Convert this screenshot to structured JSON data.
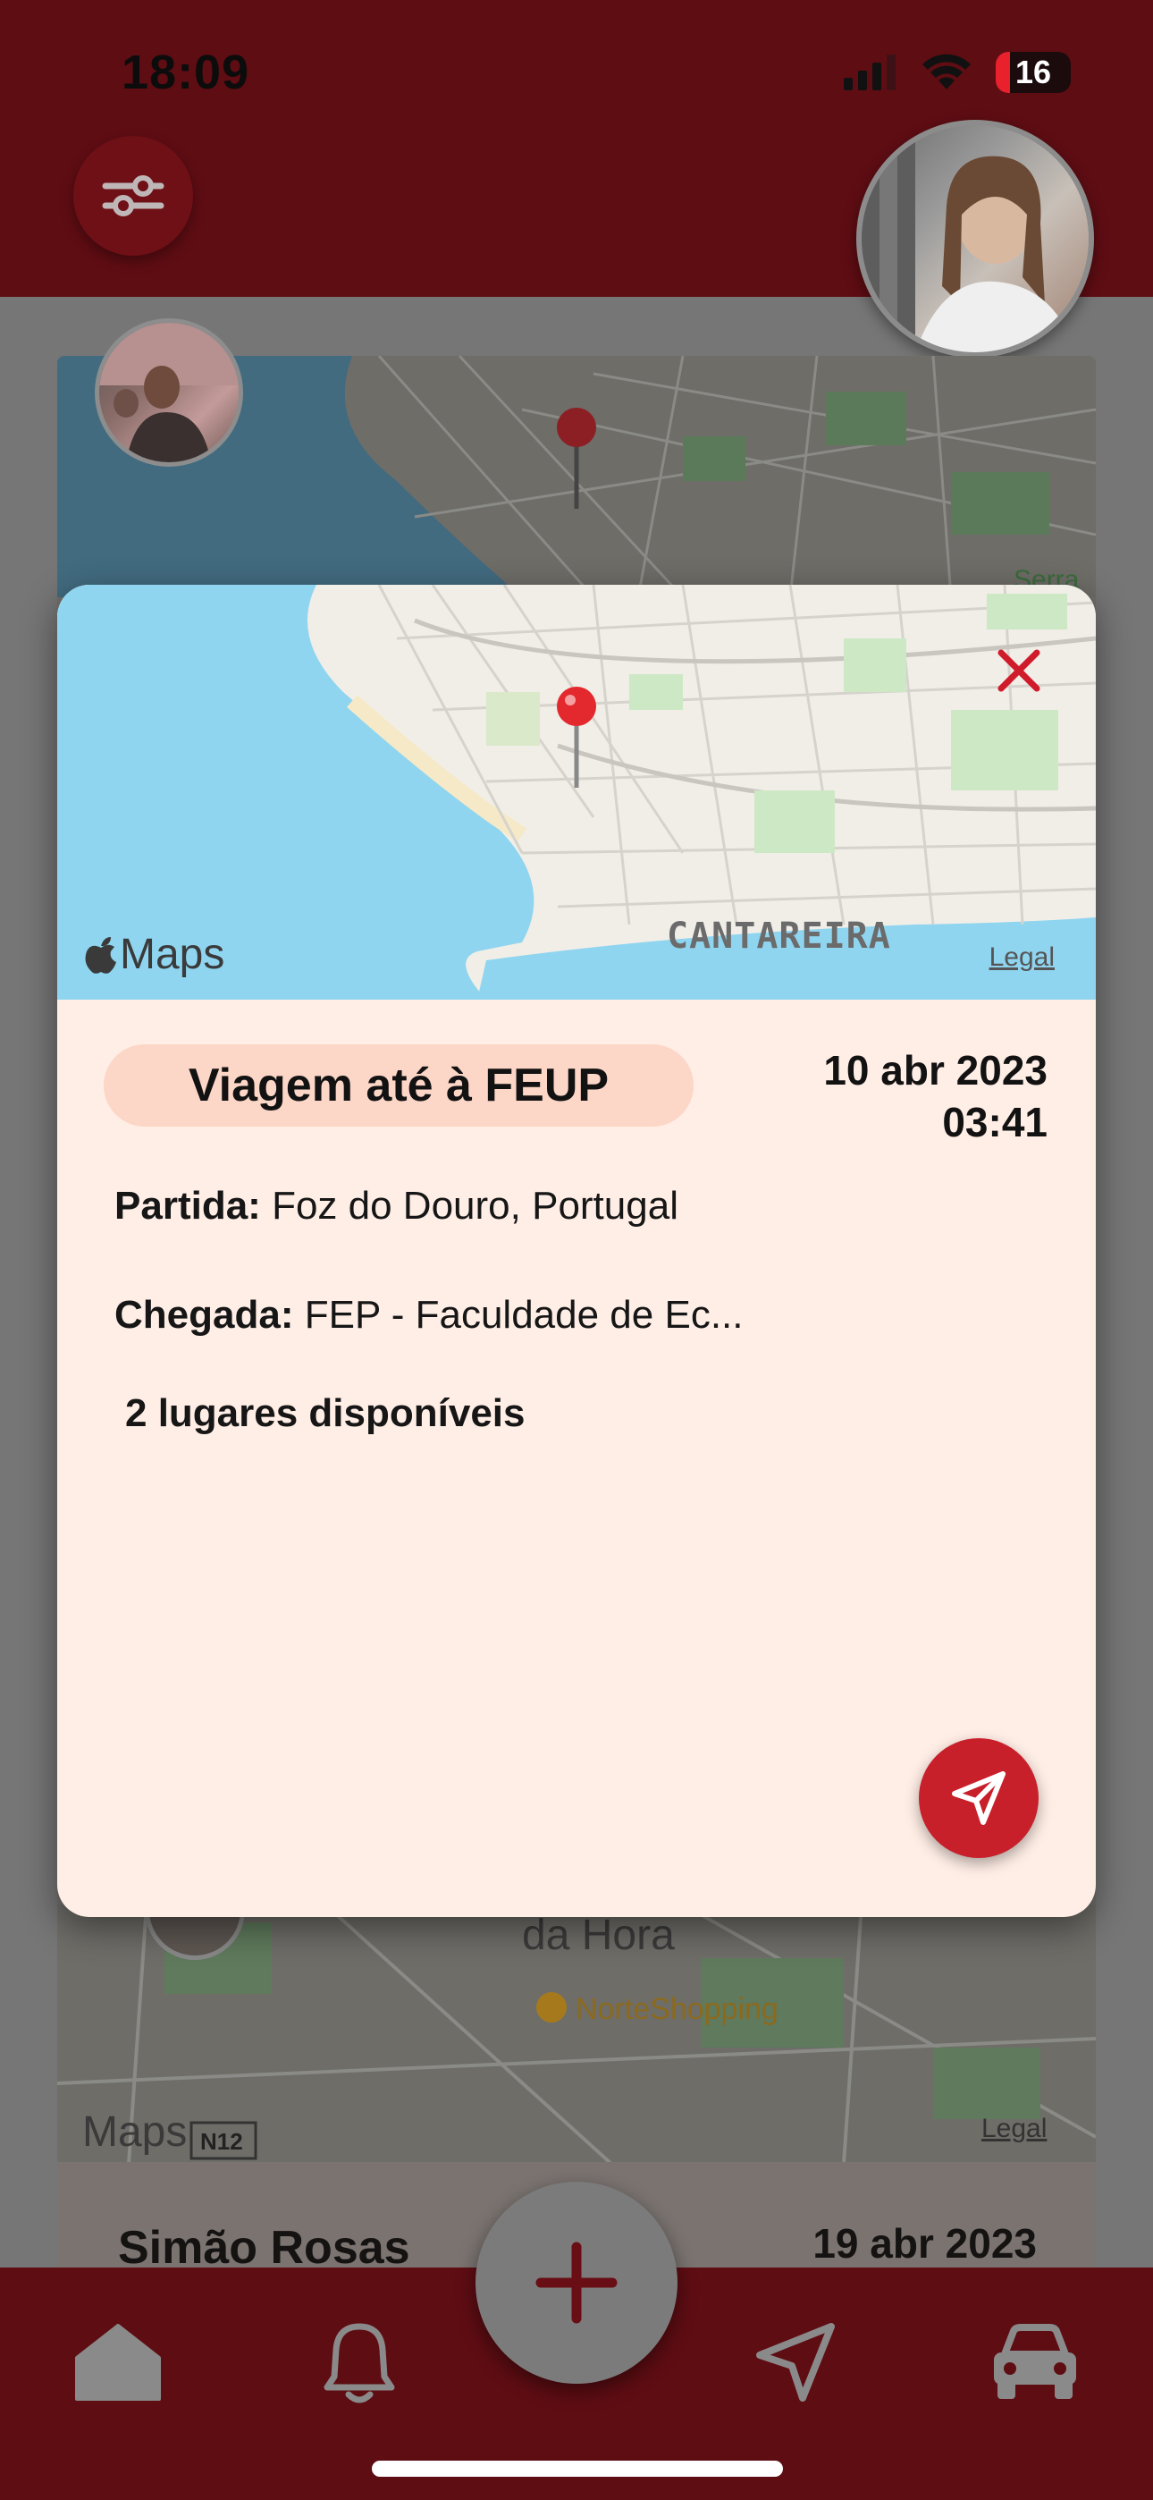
{
  "status_bar": {
    "time": "18:09",
    "battery": "16"
  },
  "header": {
    "filter_icon": "sliders-icon",
    "user_avatar": "avatar"
  },
  "modal": {
    "map": {
      "brand": "Maps",
      "legal": "Legal",
      "place_label": "CANTAREIRA",
      "close_icon": "close-icon"
    },
    "trip_title": "Viagem até à FEUP",
    "date": "10 abr 2023",
    "time": "03:41",
    "departure_label": "Partida:",
    "departure_value": "Foz do Douro, Portugal",
    "arrival_label": "Chegada:",
    "arrival_value": "FEP - Faculdade de Ec...",
    "seats": "2 lugares disponíveis",
    "send_icon": "send-icon"
  },
  "background_card": {
    "map_top_label": "Serra",
    "map_bottom_labels": [
      "da Hora",
      "NorteShopping",
      "N12"
    ],
    "brand": "Maps",
    "legal": "Legal",
    "driver_name": "Simão Rosas",
    "date": "19 abr 2023"
  },
  "bottom_nav": {
    "items": [
      "home-icon",
      "bell-icon",
      "add-icon",
      "navigation-icon",
      "car-icon"
    ]
  },
  "colors": {
    "brand": "#5e0d13",
    "accent": "#c8202a",
    "card": "#ffeee6",
    "pill": "#fcd6c6"
  }
}
